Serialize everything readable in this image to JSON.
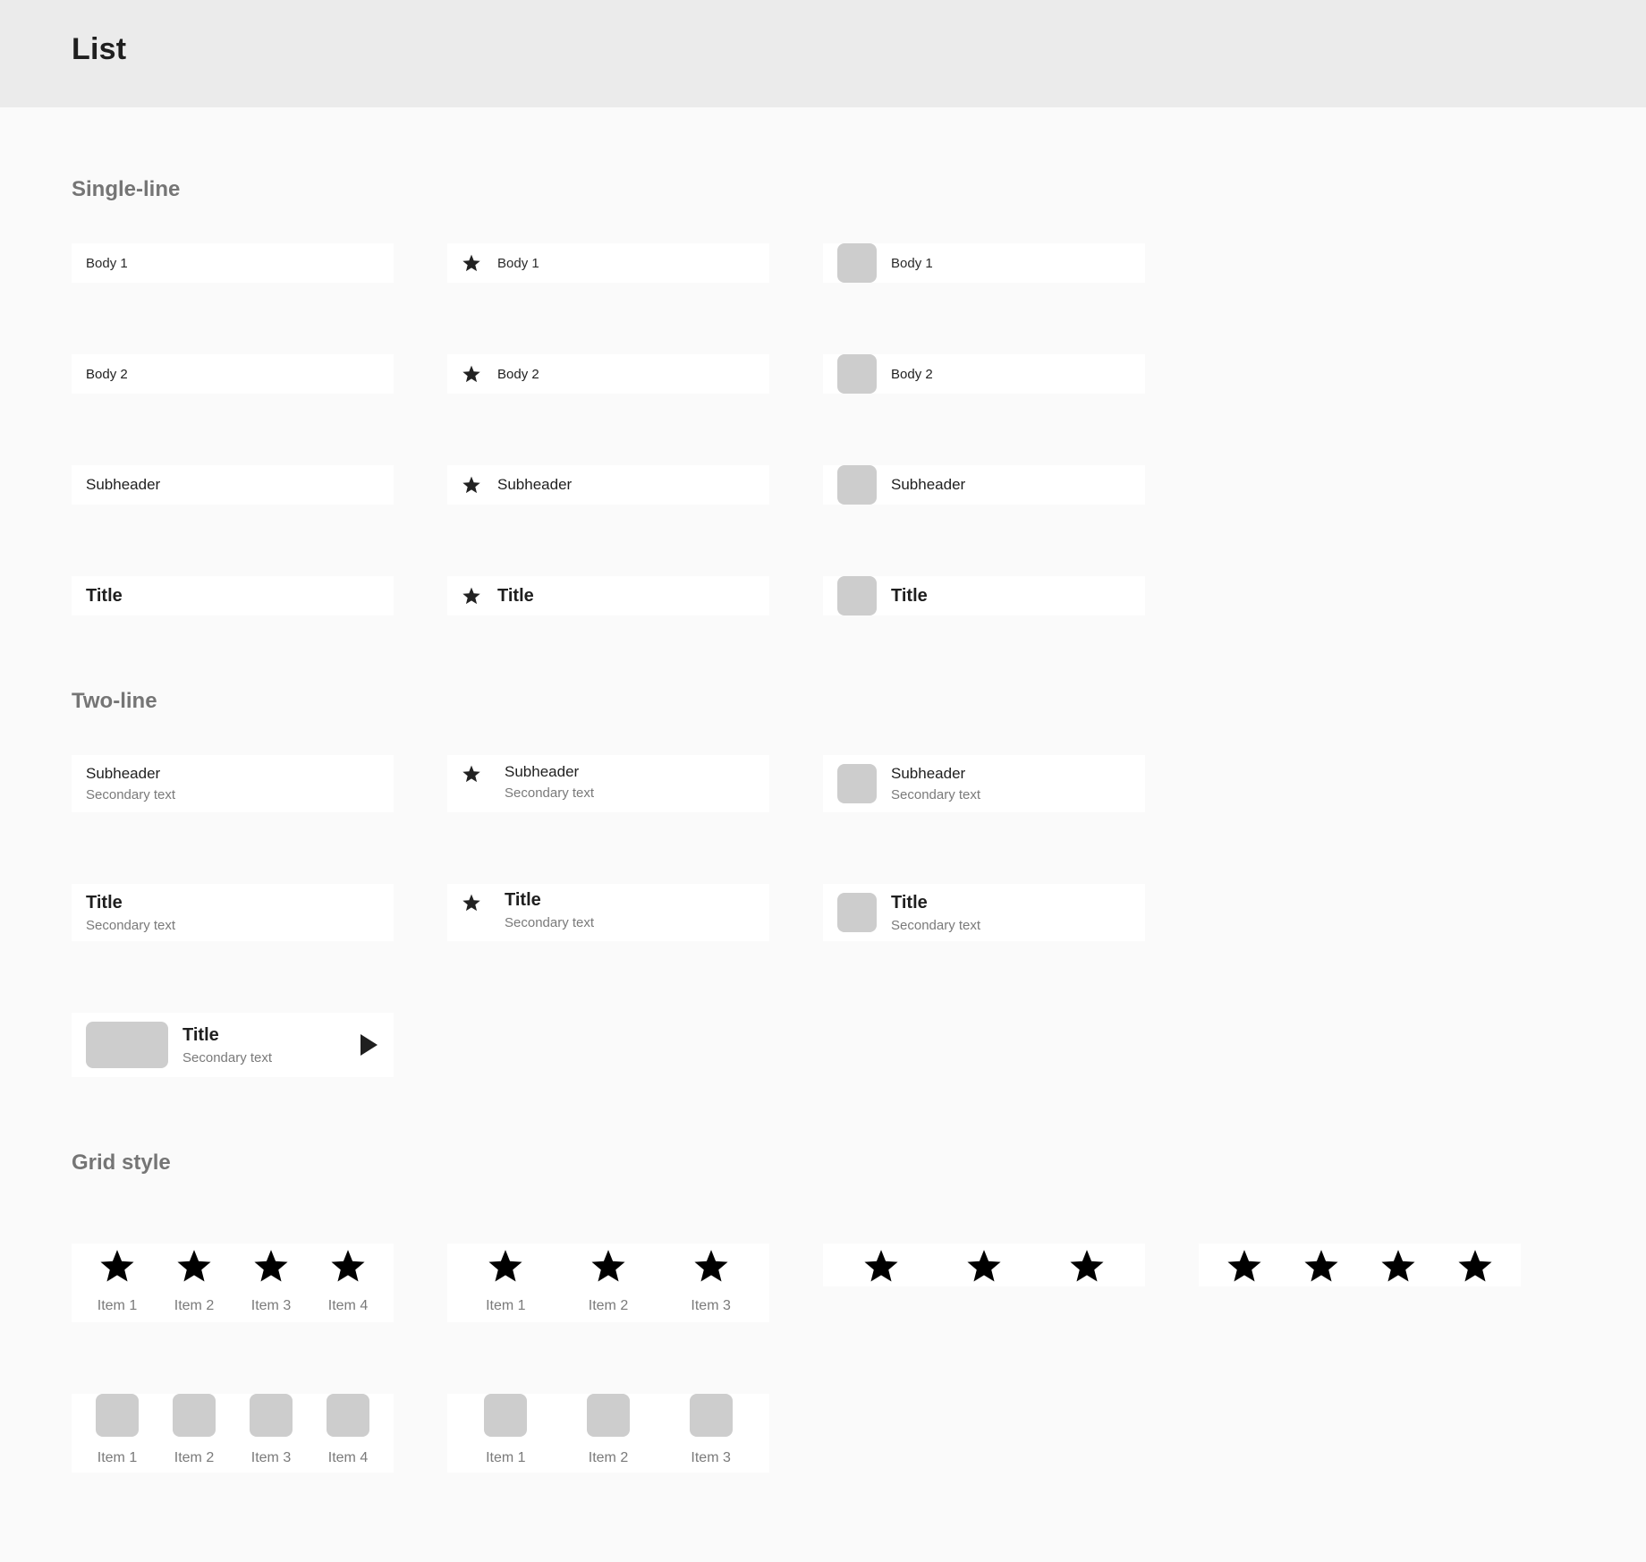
{
  "page": {
    "title": "List"
  },
  "sections": {
    "single": "Single-line",
    "two": "Two-line",
    "grid": "Grid style"
  },
  "single_line": {
    "rows": [
      {
        "text": "Body 1",
        "style": "body1"
      },
      {
        "text": "Body 2",
        "style": "body2"
      },
      {
        "text": "Subheader",
        "style": "subheader"
      },
      {
        "text": "Title",
        "style": "title"
      }
    ],
    "columns": [
      "plain",
      "star-icon",
      "thumbnail"
    ]
  },
  "two_line": {
    "rows": [
      {
        "primary": "Subheader",
        "secondary": "Secondary text"
      },
      {
        "primary": "Title",
        "secondary": "Secondary text"
      }
    ],
    "media_row": {
      "primary": "Title",
      "secondary": "Secondary text",
      "trailing_icon": "play-icon"
    }
  },
  "grid": {
    "four": [
      "Item 1",
      "Item 2",
      "Item 3",
      "Item 4"
    ],
    "three": [
      "Item 1",
      "Item 2",
      "Item 3"
    ]
  },
  "colors": {
    "header_bg": "#ebebeb",
    "page_bg": "#fafafa",
    "row_bg": "#ffffff",
    "placeholder": "#cdcdcd",
    "section_title": "#757575",
    "secondary_text": "#7a7a7a",
    "primary_text": "#1f1f1f"
  }
}
